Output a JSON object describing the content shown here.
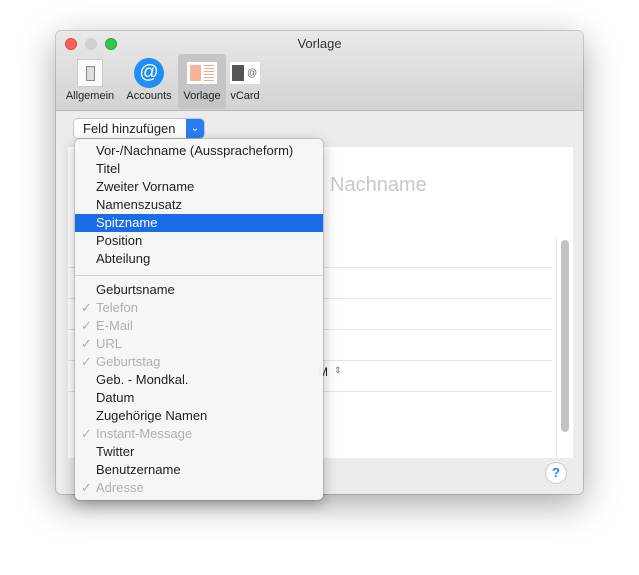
{
  "window": {
    "title": "Vorlage"
  },
  "toolbar": [
    {
      "label": "Allgemein",
      "icon": "general-icon"
    },
    {
      "label": "Accounts",
      "icon": "at-icon"
    },
    {
      "label": "Vorlage",
      "icon": "template-icon",
      "selected": true
    },
    {
      "label": "vCard",
      "icon": "vcard-icon"
    }
  ],
  "add_field": {
    "label": "Feld hinzufügen"
  },
  "panel": {
    "placeholder": "Nachname",
    "fragment": "M"
  },
  "menu": {
    "group1": [
      {
        "label": "Vor-/Nachname (Ausspracheform)"
      },
      {
        "label": "Titel"
      },
      {
        "label": "Zweiter Vorname"
      },
      {
        "label": "Namenszusatz"
      },
      {
        "label": "Spitzname",
        "highlighted": true
      },
      {
        "label": "Position"
      },
      {
        "label": "Abteilung"
      }
    ],
    "group2": [
      {
        "label": "Geburtsname",
        "checked": false
      },
      {
        "label": "Telefon",
        "checked": true
      },
      {
        "label": "E-Mail",
        "checked": true
      },
      {
        "label": "URL",
        "checked": true
      },
      {
        "label": "Geburtstag",
        "checked": true
      },
      {
        "label": "Geb. - Mondkal.",
        "checked": false
      },
      {
        "label": "Datum",
        "checked": false
      },
      {
        "label": "Zugehörige Namen",
        "checked": false
      },
      {
        "label": "Instant-Message",
        "checked": true
      },
      {
        "label": "Twitter",
        "checked": false
      },
      {
        "label": "Benutzername",
        "checked": false
      },
      {
        "label": "Adresse",
        "checked": true
      }
    ],
    "check_glyph": "✓"
  },
  "help": {
    "label": "?"
  },
  "colors": {
    "accent": "#1a6ce8"
  }
}
